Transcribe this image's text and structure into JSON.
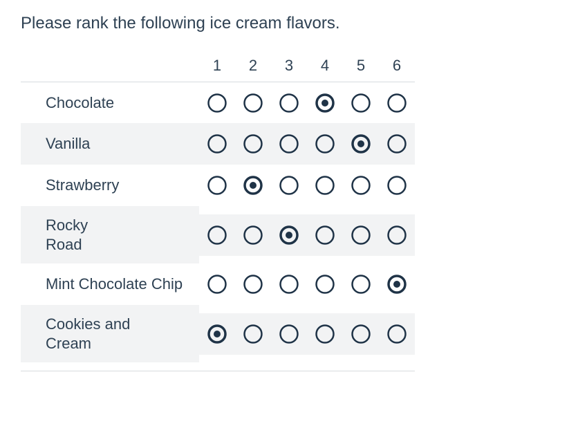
{
  "question": {
    "title": "Please rank the following ice cream flavors."
  },
  "columns": [
    "1",
    "2",
    "3",
    "4",
    "5",
    "6"
  ],
  "rows": [
    {
      "label": "Chocolate",
      "selected": 4
    },
    {
      "label": "Vanilla",
      "selected": 5
    },
    {
      "label": "Strawberry",
      "selected": 2
    },
    {
      "label": "Rocky\nRoad",
      "selected": 3
    },
    {
      "label": "Mint Chocolate Chip",
      "selected": 6
    },
    {
      "label": "Cookies and\nCream",
      "selected": 1
    }
  ],
  "style": {
    "radio_stroke": "#1f3347",
    "radio_fill": "#1f3347"
  }
}
